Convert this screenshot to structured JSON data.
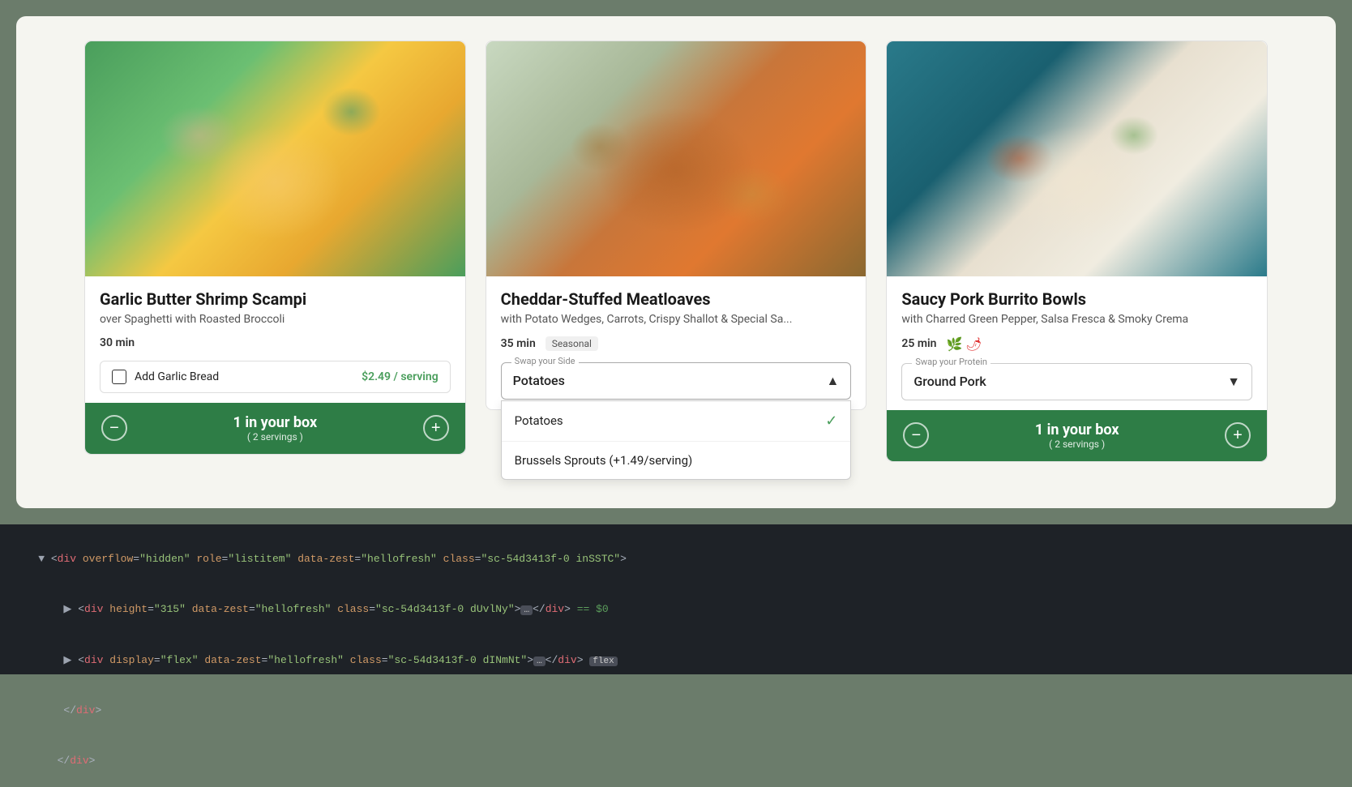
{
  "page": {
    "background_color": "#6b7c6b"
  },
  "cards": [
    {
      "id": "shrimp-scampi",
      "title": "Garlic Butter Shrimp Scampi",
      "subtitle": "over Spaghetti with Roasted Broccoli",
      "time": "30 min",
      "badge": null,
      "icons": [],
      "swap_label": null,
      "swap_value": null,
      "addon": {
        "label": "Add Garlic Bread",
        "price": "$2.49 / serving",
        "checked": false
      },
      "count": "1 in your box",
      "servings": "( 2 servings )",
      "image_class": "img-shrimp",
      "dropdown_open": false
    },
    {
      "id": "meatloaf",
      "title": "Cheddar-Stuffed Meatloaves",
      "subtitle": "with Potato Wedges, Carrots, Crispy Shallot & Special Sa...",
      "time": "35 min",
      "badge": "Seasonal",
      "icons": [],
      "swap_label": "Swap your Side",
      "swap_value": "Potatoes",
      "addon": null,
      "count": null,
      "servings": null,
      "image_class": "img-meatloaf",
      "dropdown_open": true,
      "dropdown_items": [
        {
          "label": "Potatoes",
          "selected": true,
          "extra": null
        },
        {
          "label": "Brussels Sprouts (+1.49/serving)",
          "selected": false,
          "extra": null
        }
      ]
    },
    {
      "id": "burrito-bowls",
      "title": "Saucy Pork Burrito Bowls",
      "subtitle": "with Charred Green Pepper, Salsa Fresca & Smoky Crema",
      "time": "25 min",
      "badge": null,
      "icons": [
        "leaf",
        "chili"
      ],
      "swap_label": "Swap your Protein",
      "swap_value": "Ground Pork",
      "addon": null,
      "count": "1 in your box",
      "servings": "( 2 servings )",
      "image_class": "img-burrito",
      "dropdown_open": false
    }
  ],
  "devtools": {
    "lines": [
      {
        "indent": 2,
        "content": "▼ <div overflow=\"hidden\" role=\"listitem\" data-zest=\"hellofresh\" class=\"sc-54d3413f-0 inSSTC\">"
      },
      {
        "indent": 3,
        "content": "  ▶ <div height=\"315\" data-zest=\"hellofresh\" class=\"sc-54d3413f-0 dUvlNy\">…</div> == $0"
      },
      {
        "indent": 3,
        "content": "  ▶ <div display=\"flex\" data-zest=\"hellofresh\" class=\"sc-54d3413f-0 dINmNt\">…</div>"
      },
      {
        "indent": 2,
        "content": "</div>"
      },
      {
        "indent": 1,
        "content": "</div>"
      }
    ]
  },
  "labels": {
    "in_your_box": "1 in your box",
    "two_servings": "( 2 servings )",
    "potatoes": "Potatoes",
    "brussels": "Brussels Sprouts (+1.49/serving)"
  }
}
